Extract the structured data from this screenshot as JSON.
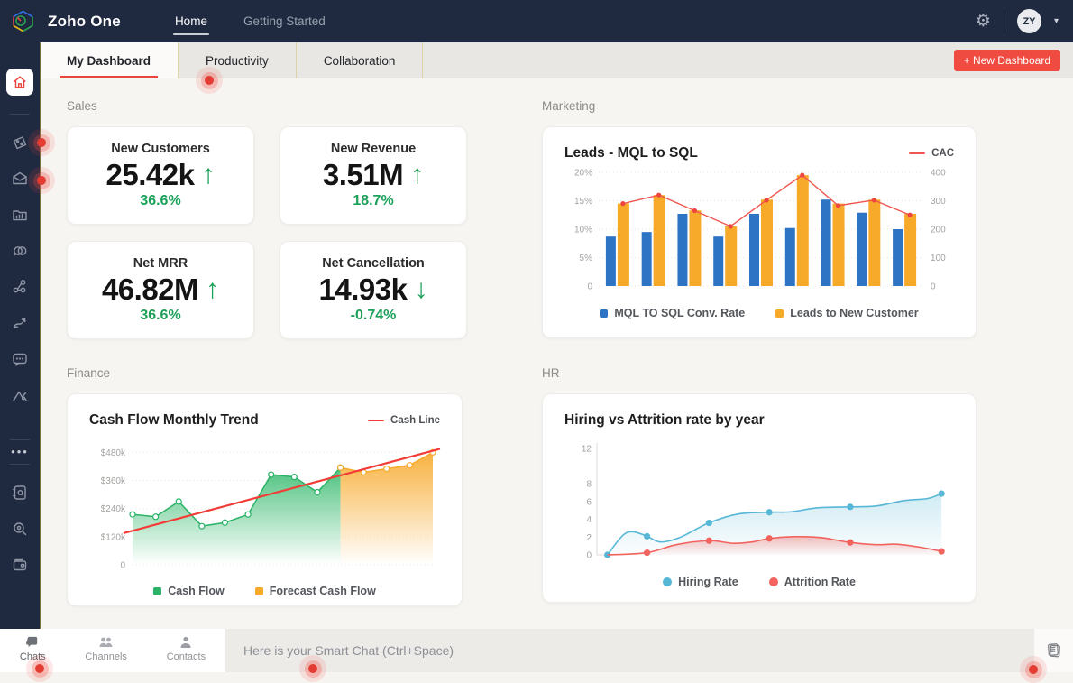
{
  "colors": {
    "navy": "#1f2940",
    "accent_red": "#f04b41",
    "green": "#1ca15a",
    "bar_blue": "#2e74c4",
    "bar_yellow": "#f7a92a",
    "line_red": "#f0554f",
    "hr_blue": "#56b7d6",
    "hr_red": "#f2635e"
  },
  "topbar": {
    "brand": "Zoho One",
    "nav": [
      {
        "label": "Home",
        "active": true
      },
      {
        "label": "Getting Started",
        "active": false
      }
    ],
    "avatar_initials": "ZY"
  },
  "tabs": {
    "items": [
      {
        "label": "My Dashboard"
      },
      {
        "label": "Productivity"
      },
      {
        "label": "Collaboration"
      }
    ],
    "new_dashboard_label": "+ New Dashboard"
  },
  "sections": {
    "sales": "Sales",
    "marketing": "Marketing",
    "finance": "Finance",
    "hr": "HR"
  },
  "kpis": [
    {
      "title": "New Customers",
      "value": "25.42k",
      "trend": "up",
      "arrow": "↑",
      "percent": "36.6%"
    },
    {
      "title": "New Revenue",
      "value": "3.51M",
      "trend": "up",
      "arrow": "↑",
      "percent": "18.7%"
    },
    {
      "title": "Net MRR",
      "value": "46.82M",
      "trend": "up",
      "arrow": "↑",
      "percent": "36.6%"
    },
    {
      "title": "Net Cancellation",
      "value": "14.93k",
      "trend": "down",
      "arrow": "↓",
      "percent": "-0.74%"
    }
  ],
  "chart_data": [
    {
      "id": "marketing",
      "type": "bar",
      "title": "Leads - MQL to SQL",
      "left_max": 20,
      "right_max": 400,
      "left_ticks": [
        {
          "v": 20,
          "label": "20%"
        },
        {
          "v": 15,
          "label": "15%"
        },
        {
          "v": 10,
          "label": "10%"
        },
        {
          "v": 5,
          "label": "5%"
        },
        {
          "v": 0,
          "label": "0"
        }
      ],
      "right_ticks": [
        {
          "v": 400,
          "label": "400"
        },
        {
          "v": 300,
          "label": "300"
        },
        {
          "v": 200,
          "label": "200"
        },
        {
          "v": 100,
          "label": "100"
        },
        {
          "v": 0,
          "label": "0"
        }
      ],
      "series": [
        {
          "name": "MQL TO SQL Conv. Rate",
          "type": "bar",
          "color": "#2e74c4",
          "values": [
            8.7,
            9.5,
            12.7,
            8.7,
            12.7,
            10.2,
            15.2,
            12.9,
            10.0
          ]
        },
        {
          "name": "Leads to New Customer",
          "type": "bar",
          "color": "#f7a92a",
          "values": [
            14.5,
            16.0,
            13.3,
            10.5,
            15.2,
            19.5,
            14.5,
            15.2,
            12.7
          ]
        },
        {
          "name": "CAC",
          "type": "line",
          "axis": "right",
          "color": "#f0554f",
          "values": [
            290,
            320,
            265,
            210,
            302,
            390,
            283,
            302,
            250
          ]
        }
      ],
      "legend_position": "bottom"
    },
    {
      "id": "finance",
      "type": "area",
      "title": "Cash Flow Monthly Trend",
      "ymax": 520,
      "yticks": [
        {
          "v": 480,
          "label": "$480k"
        },
        {
          "v": 360,
          "label": "$360k"
        },
        {
          "v": 240,
          "label": "$240k"
        },
        {
          "v": 120,
          "label": "$120k"
        },
        {
          "v": 0,
          "label": "0"
        }
      ],
      "series": [
        {
          "name": "Cash Flow",
          "color": "#2ab266",
          "values": [
            215,
            205,
            270,
            165,
            180,
            215,
            385,
            375,
            310,
            415
          ]
        },
        {
          "name": "Forecast Cash Flow",
          "color": "#f7a92a",
          "values": [
            415,
            395,
            410,
            425,
            480
          ]
        },
        {
          "name": "Cash Line",
          "type": "trend",
          "color": "#f23c36",
          "from": 135,
          "to": 495
        }
      ],
      "legend_position": "bottom"
    },
    {
      "id": "hr",
      "type": "line",
      "title": "Hiring vs Attrition rate by year",
      "ymax": 13,
      "yticks": [
        {
          "v": 12,
          "label": "12"
        },
        {
          "v": 8,
          "label": "8"
        },
        {
          "v": 6,
          "label": "6"
        },
        {
          "v": 4,
          "label": "4"
        },
        {
          "v": 2,
          "label": "2"
        },
        {
          "v": 0,
          "label": "0"
        }
      ],
      "series": [
        {
          "name": "Hiring Rate",
          "color": "#56b7d6",
          "path": [
            [
              0.02,
              0
            ],
            [
              0.065,
              2.2
            ],
            [
              0.095,
              2.6
            ],
            [
              0.135,
              2.1
            ],
            [
              0.175,
              1.45
            ],
            [
              0.23,
              1.95
            ],
            [
              0.315,
              3.6
            ],
            [
              0.4,
              4.6
            ],
            [
              0.49,
              4.8
            ],
            [
              0.555,
              4.85
            ],
            [
              0.63,
              5.3
            ],
            [
              0.725,
              5.4
            ],
            [
              0.8,
              5.5
            ],
            [
              0.88,
              6.1
            ],
            [
              0.95,
              6.35
            ],
            [
              0.99,
              6.9
            ]
          ],
          "markers": [
            [
              0.02,
              0
            ],
            [
              0.135,
              2.1
            ],
            [
              0.315,
              3.6
            ],
            [
              0.49,
              4.8
            ],
            [
              0.725,
              5.4
            ],
            [
              0.99,
              6.9
            ]
          ]
        },
        {
          "name": "Attrition Rate",
          "color": "#f2635e",
          "path": [
            [
              0.02,
              0
            ],
            [
              0.135,
              0.25
            ],
            [
              0.22,
              1.15
            ],
            [
              0.315,
              1.6
            ],
            [
              0.385,
              1.3
            ],
            [
              0.44,
              1.45
            ],
            [
              0.49,
              1.85
            ],
            [
              0.56,
              2.05
            ],
            [
              0.64,
              1.95
            ],
            [
              0.725,
              1.4
            ],
            [
              0.8,
              1.15
            ],
            [
              0.86,
              1.2
            ],
            [
              0.93,
              0.85
            ],
            [
              0.99,
              0.4
            ]
          ],
          "markers": [
            [
              0.135,
              0.25
            ],
            [
              0.315,
              1.6
            ],
            [
              0.49,
              1.85
            ],
            [
              0.725,
              1.4
            ],
            [
              0.99,
              0.4
            ]
          ]
        }
      ],
      "legend_position": "bottom"
    }
  ],
  "chatbar": {
    "tabs": [
      {
        "label": "Chats"
      },
      {
        "label": "Channels"
      },
      {
        "label": "Contacts"
      }
    ],
    "placeholder": "Here is your Smart Chat (Ctrl+Space)"
  }
}
